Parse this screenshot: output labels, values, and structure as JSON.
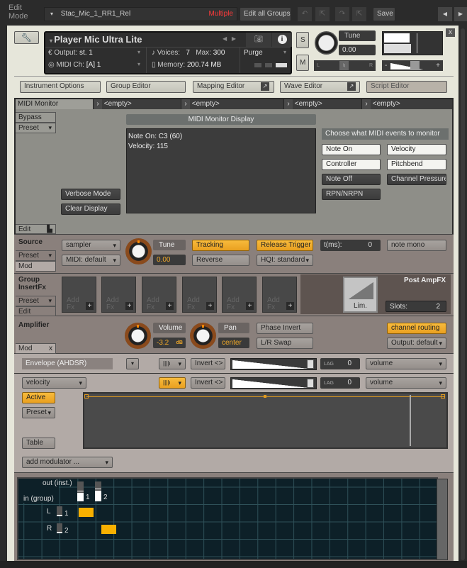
{
  "topbar": {
    "mode_label": "Edit\nMode",
    "edit_line1": "Edit",
    "edit_line2": "Mode",
    "group_name": "Stac_Mic_1_RR1_Rel",
    "group_status": "Multiple",
    "edit_all_groups": "Edit all Groups",
    "save": "Save"
  },
  "instrument": {
    "name": "Player Mic Ultra Lite",
    "output_label": "Output:",
    "output_value": "st. 1",
    "midi_label": "MIDI Ch:",
    "midi_value": "[A]  1",
    "voices_label": "Voices:",
    "voices_value": "7",
    "max_label": "Max:",
    "max_value": "300",
    "memory_label": "Memory:",
    "memory_value": "200.74 MB",
    "purge": "Purge",
    "solo": "S",
    "mute": "M",
    "tune_label": "Tune",
    "tune_value": "0.00",
    "pan_l": "L",
    "pan_r": "R",
    "vol_minus": "-",
    "vol_plus": "+",
    "close": "x"
  },
  "editors": [
    "Instrument Options",
    "Group Editor",
    "Mapping Editor",
    "Wave Editor",
    "Script Editor"
  ],
  "script": {
    "tabs": [
      "MIDI Monitor",
      "<empty>",
      "<empty>",
      "<empty>",
      "<empty>"
    ],
    "bypass": "Bypass",
    "preset": "Preset",
    "edit": "Edit",
    "display_title": "MIDI Monitor Display",
    "display_lines": [
      "Note On: C3  (60)",
      "Velocity: 115"
    ],
    "verbose": "Verbose Mode",
    "clear": "Clear Display",
    "choose_label": "Choose what MIDI events to monitor",
    "events": [
      "Note On",
      "Velocity",
      "Controller",
      "Pitchbend",
      "Note Off",
      "Channel Pressure",
      "RPN/NRPN"
    ]
  },
  "source": {
    "title": "Source",
    "preset": "Preset",
    "mod": "Mod",
    "mode": "sampler",
    "midi": "MIDI: default",
    "tune_label": "Tune",
    "tune_value": "0.00",
    "tracking": "Tracking",
    "reverse": "Reverse",
    "release_trigger": "Release Trigger",
    "hqi": "HQI: standard",
    "tms_label": "t(ms):",
    "tms_value": "0",
    "note_mono": "note mono"
  },
  "insertfx": {
    "title1": "Group",
    "title2": "InsertFx",
    "preset": "Preset",
    "edit": "Edit",
    "slot_label1": "Add",
    "slot_label2": "Fx",
    "plus": "+",
    "post_title": "Post AmpFX",
    "lim": "Lim.",
    "slots_label": "Slots:",
    "slots_value": "2"
  },
  "amplifier": {
    "title": "Amplifier",
    "volume_label": "Volume",
    "volume_value": "-3.2",
    "volume_unit": "dB",
    "pan_label": "Pan",
    "pan_value": "center",
    "phase_invert": "Phase Invert",
    "lr_swap": "L/R Swap",
    "channel_routing": "channel routing",
    "output": "Output: default",
    "mod": "Mod",
    "mod_close": "x"
  },
  "modulation": {
    "row1": {
      "source": "Envelope (AHDSR)",
      "invert": "Invert <>",
      "lag_label": "LAG",
      "lag_value": "0",
      "target": "volume"
    },
    "row2": {
      "source": "velocity",
      "invert": "Invert <>",
      "lag_label": "LAG",
      "lag_value": "0",
      "target": "volume"
    },
    "active": "Active",
    "preset": "Preset",
    "table": "Table",
    "add_modulator": "add modulator ..."
  },
  "routing": {
    "out_label": "out (inst.)",
    "in_label": "in (group)",
    "outs": [
      "1",
      "2"
    ],
    "inputs": [
      {
        "ch": "L",
        "num": "1"
      },
      {
        "ch": "R",
        "num": "2"
      }
    ]
  },
  "colors": {
    "accent": "#f0a828",
    "warning": "#ff3a3a",
    "grid_bg": "#0d2028"
  }
}
